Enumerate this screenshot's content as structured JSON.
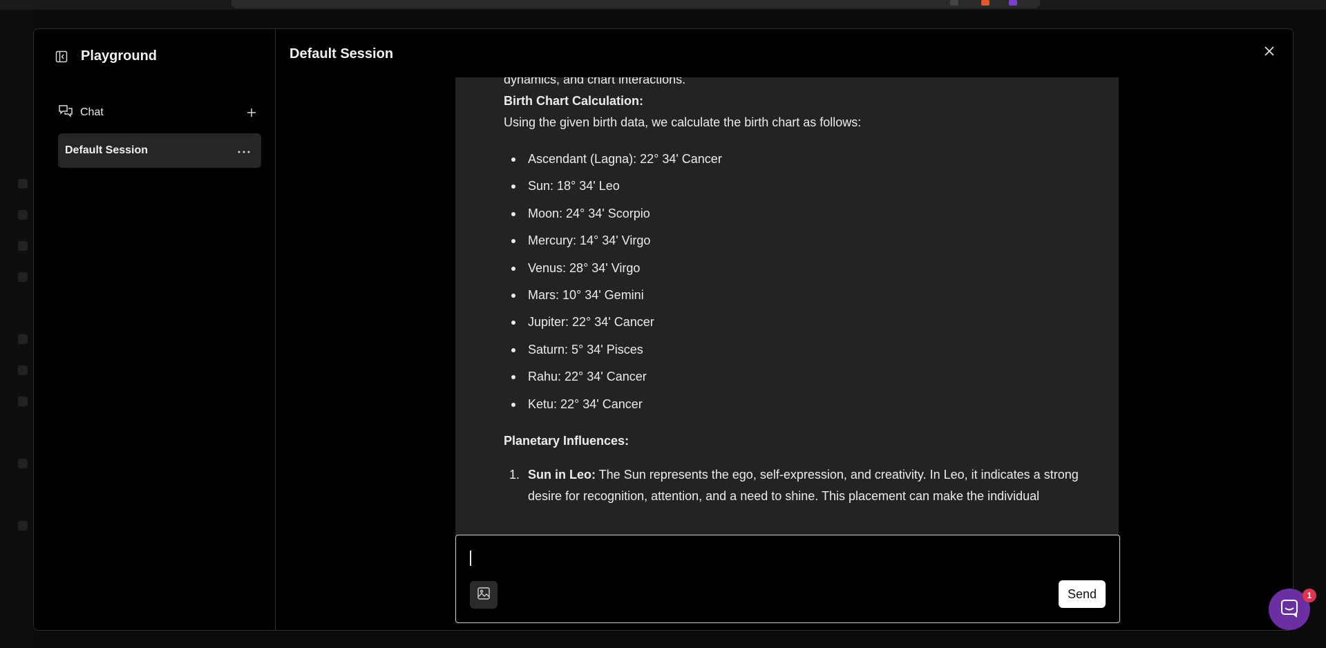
{
  "sidebar": {
    "title": "Playground",
    "chat_label": "Chat",
    "session_label": "Default Session"
  },
  "main": {
    "title": "Default Session"
  },
  "message": {
    "intro_line": "dynamics, and chart interactions.",
    "birth_chart_heading": "Birth Chart Calculation:",
    "birth_chart_intro": "Using the given birth data, we calculate the birth chart as follows:",
    "placements": [
      "Ascendant (Lagna): 22° 34' Cancer",
      "Sun: 18° 34' Leo",
      "Moon: 24° 34' Scorpio",
      "Mercury: 14° 34' Virgo",
      "Venus: 28° 34' Virgo",
      "Mars: 10° 34' Gemini",
      "Jupiter: 22° 34' Cancer",
      "Saturn: 5° 34' Pisces",
      "Rahu: 22° 34' Cancer",
      "Ketu: 22° 34' Cancer"
    ],
    "influences_heading": "Planetary Influences:",
    "influences": [
      {
        "number": "1.",
        "title": "Sun in Leo:",
        "text": " The Sun represents the ego, self-expression, and creativity. In Leo, it indicates a strong desire for recognition, attention, and a need to shine. This placement can make the individual"
      }
    ]
  },
  "input": {
    "placeholder": "",
    "send_label": "Send"
  },
  "widget": {
    "badge_count": "1",
    "accent": "#6b2fa3",
    "badge_color": "#e0344e"
  }
}
